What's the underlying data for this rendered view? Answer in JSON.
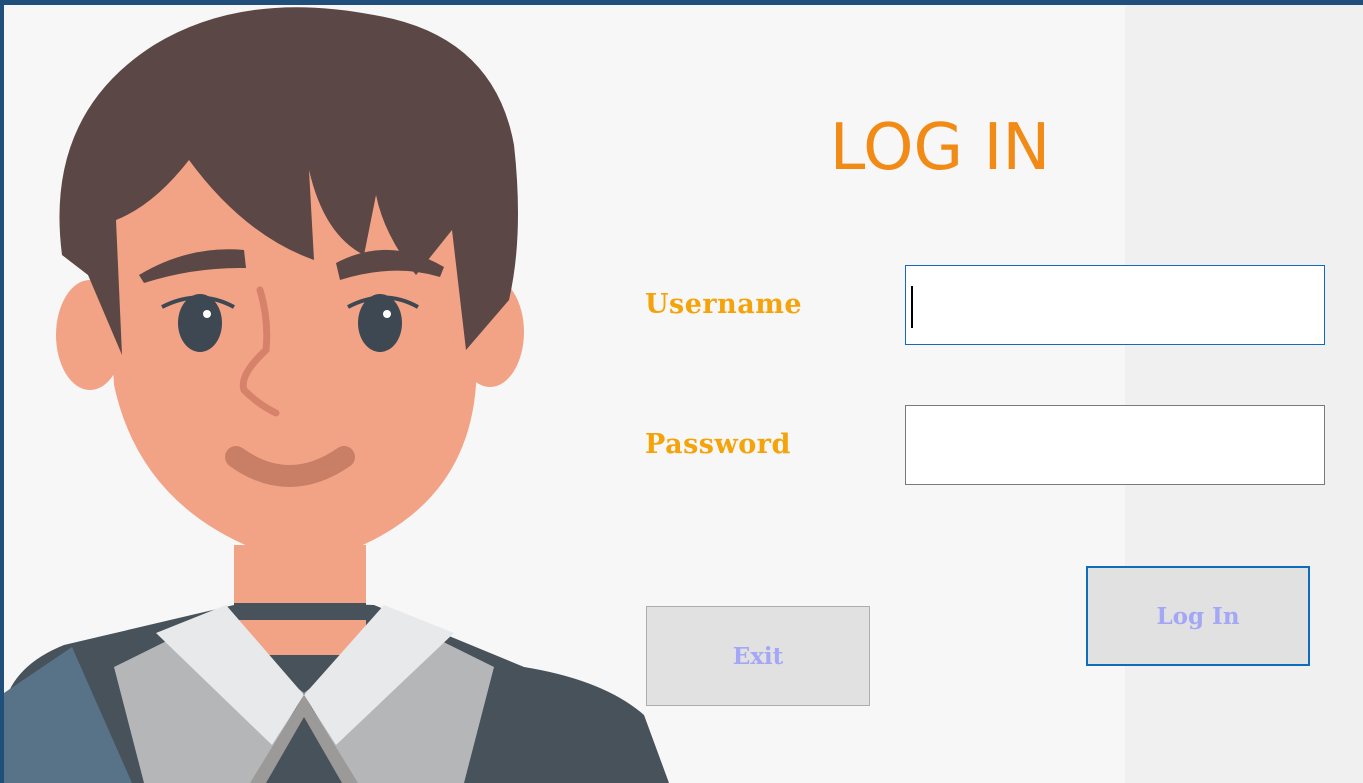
{
  "form": {
    "title": "LOG IN",
    "username_label": "Username",
    "password_label": "Password",
    "username_value": "",
    "password_value": ""
  },
  "buttons": {
    "exit_label": "Exit",
    "login_label": "Log In"
  },
  "colors": {
    "title": "#f28a16",
    "labels": "#f5a30a",
    "button_text": "#a3a7f5",
    "focus_border": "#0f6cbd",
    "window_border": "#1f4f7a"
  },
  "illustration": {
    "icon": "user-avatar-icon"
  }
}
